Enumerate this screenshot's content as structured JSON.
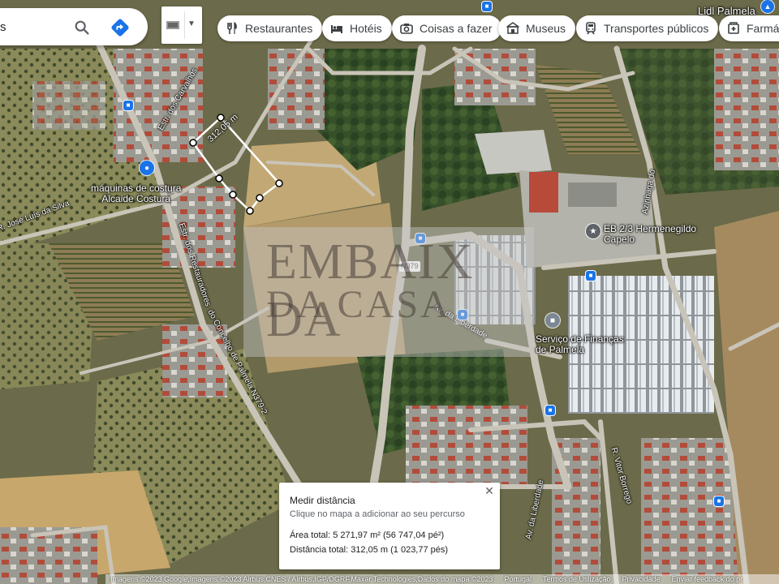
{
  "search": {
    "value": "s",
    "placeholder": ""
  },
  "chips": [
    {
      "label": "Restaurantes",
      "icon": "fork-knife-icon"
    },
    {
      "label": "Hotéis",
      "icon": "bed-icon"
    },
    {
      "label": "Coisas a fazer",
      "icon": "camera-icon"
    },
    {
      "label": "Museus",
      "icon": "museum-icon"
    },
    {
      "label": "Transportes públicos",
      "icon": "train-icon"
    },
    {
      "label": "Farmác",
      "icon": "pharmacy-icon"
    }
  ],
  "map_labels": {
    "lidl": "Lidl Palmela",
    "maquinas_line1": "máquinas de costura",
    "maquinas_line2": "Alcaide Costura",
    "eb_line1": "EB 2/3 Hermenegildo",
    "eb_line2": "Capelo",
    "financas_line1": "Serviço de Finanças",
    "financas_line2": "de Palmela",
    "road_n379": "N379",
    "street_carvalhos": "Estr. dos Carvalhos",
    "street_jose_luis": "R. José Luís da Silva",
    "street_restauradores_a": "Estr. dos Restauradores",
    "street_restauradores_b": "do Concelho de Palmela N379-2",
    "street_liberdade_a": "Av. da Liberdade",
    "street_liberdade_b": "Av. da Liberdade",
    "street_terriga": "Azinhaga do",
    "street_vitor": "R. Vitor Borrego",
    "measure_segment": "312,05 m"
  },
  "watermark": {
    "line1": "EMBAIX DA",
    "line2": "DA CASA"
  },
  "measure": {
    "title": "Medir distância",
    "hint": "Clique no mapa a adicionar ao seu percurso",
    "area": "Área total: 5 271,97 m² (56 747,04 pé²)",
    "distance": "Distância total: 312,05 m (1 023,77 pés)"
  },
  "footer": {
    "imagery": "Imagens ©2023 Google,Imagens ©2023 Airbus,CNES / Airbus,IGP/DGRF,Maxar Technologies,Dados do mapa ©2023",
    "country": "Portugal",
    "terms": "Termos de Utilização",
    "privacy": "Privacidade",
    "feedback": "Enviar feedback do pr"
  },
  "colors": {
    "accent": "#1a73e8",
    "poi_school": "#5f6368",
    "poi_finance": "#7b8794",
    "poi_shop": "#1a73e8"
  }
}
